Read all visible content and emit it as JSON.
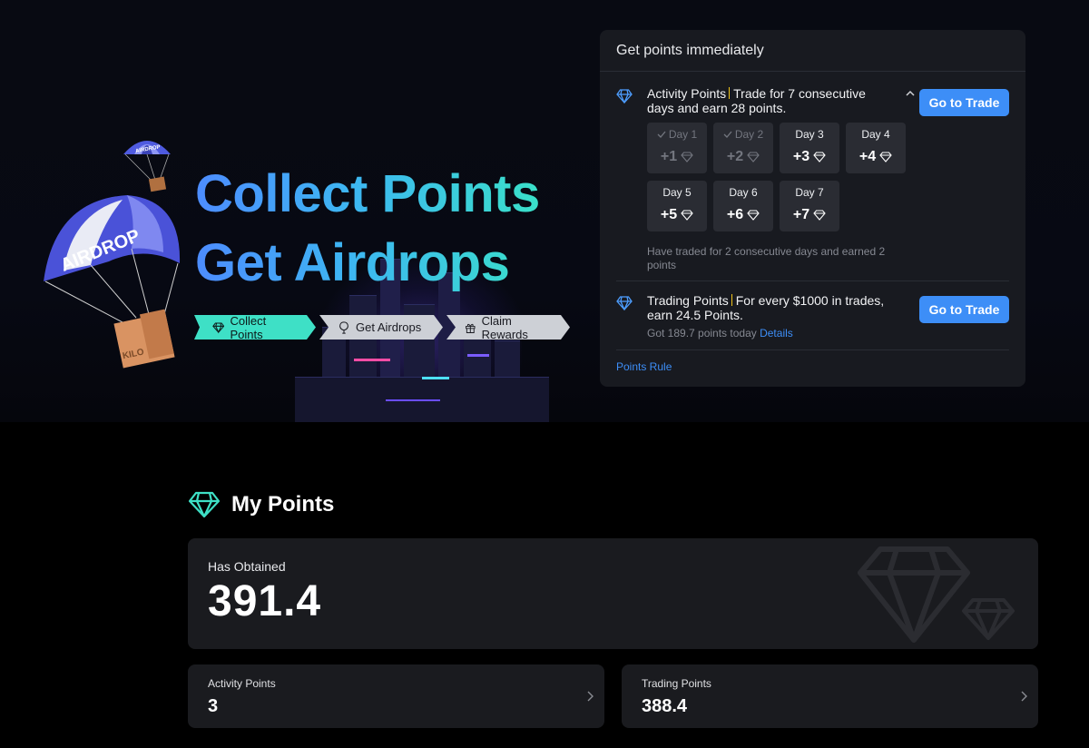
{
  "hero": {
    "headline_line1": "Collect Points",
    "headline_line2": "Get Airdrops",
    "parachute_large_text": "AIRDROP",
    "parachute_small_text": "AIRDROP",
    "box_text": "KILO",
    "steps": [
      {
        "label": "Collect Points",
        "icon": "diamond-icon"
      },
      {
        "label": "Get Airdrops",
        "icon": "balloon-icon"
      },
      {
        "label": "Claim Rewards",
        "icon": "gift-icon"
      }
    ]
  },
  "panel": {
    "title": "Get points immediately",
    "activity": {
      "name": "Activity Points",
      "desc": "Trade for 7 consecutive days and earn 28 points.",
      "button": "Go to Trade",
      "days": [
        {
          "label": "Day 1",
          "value": "+1",
          "done": true
        },
        {
          "label": "Day 2",
          "value": "+2",
          "done": true
        },
        {
          "label": "Day 3",
          "value": "+3",
          "done": false
        },
        {
          "label": "Day 4",
          "value": "+4",
          "done": false
        },
        {
          "label": "Day 5",
          "value": "+5",
          "done": false
        },
        {
          "label": "Day 6",
          "value": "+6",
          "done": false
        },
        {
          "label": "Day 7",
          "value": "+7",
          "done": false
        }
      ],
      "note": "Have traded for 2 consecutive days and earned 2 points"
    },
    "trading": {
      "name": "Trading Points",
      "desc": "For every $1000 in trades, earn 24.5 Points.",
      "button": "Go to Trade",
      "got": "Got 189.7 points today",
      "details": "Details"
    },
    "rule_link": "Points Rule"
  },
  "my_points": {
    "title": "My Points",
    "obtained_label": "Has Obtained",
    "obtained_value": "391.4",
    "activity_label": "Activity Points",
    "activity_value": "3",
    "trading_label": "Trading Points",
    "trading_value": "388.4"
  },
  "colors": {
    "accent_blue": "#3d8ef7",
    "accent_teal": "#3ee0c6",
    "gold_divider": "#f0c419"
  }
}
